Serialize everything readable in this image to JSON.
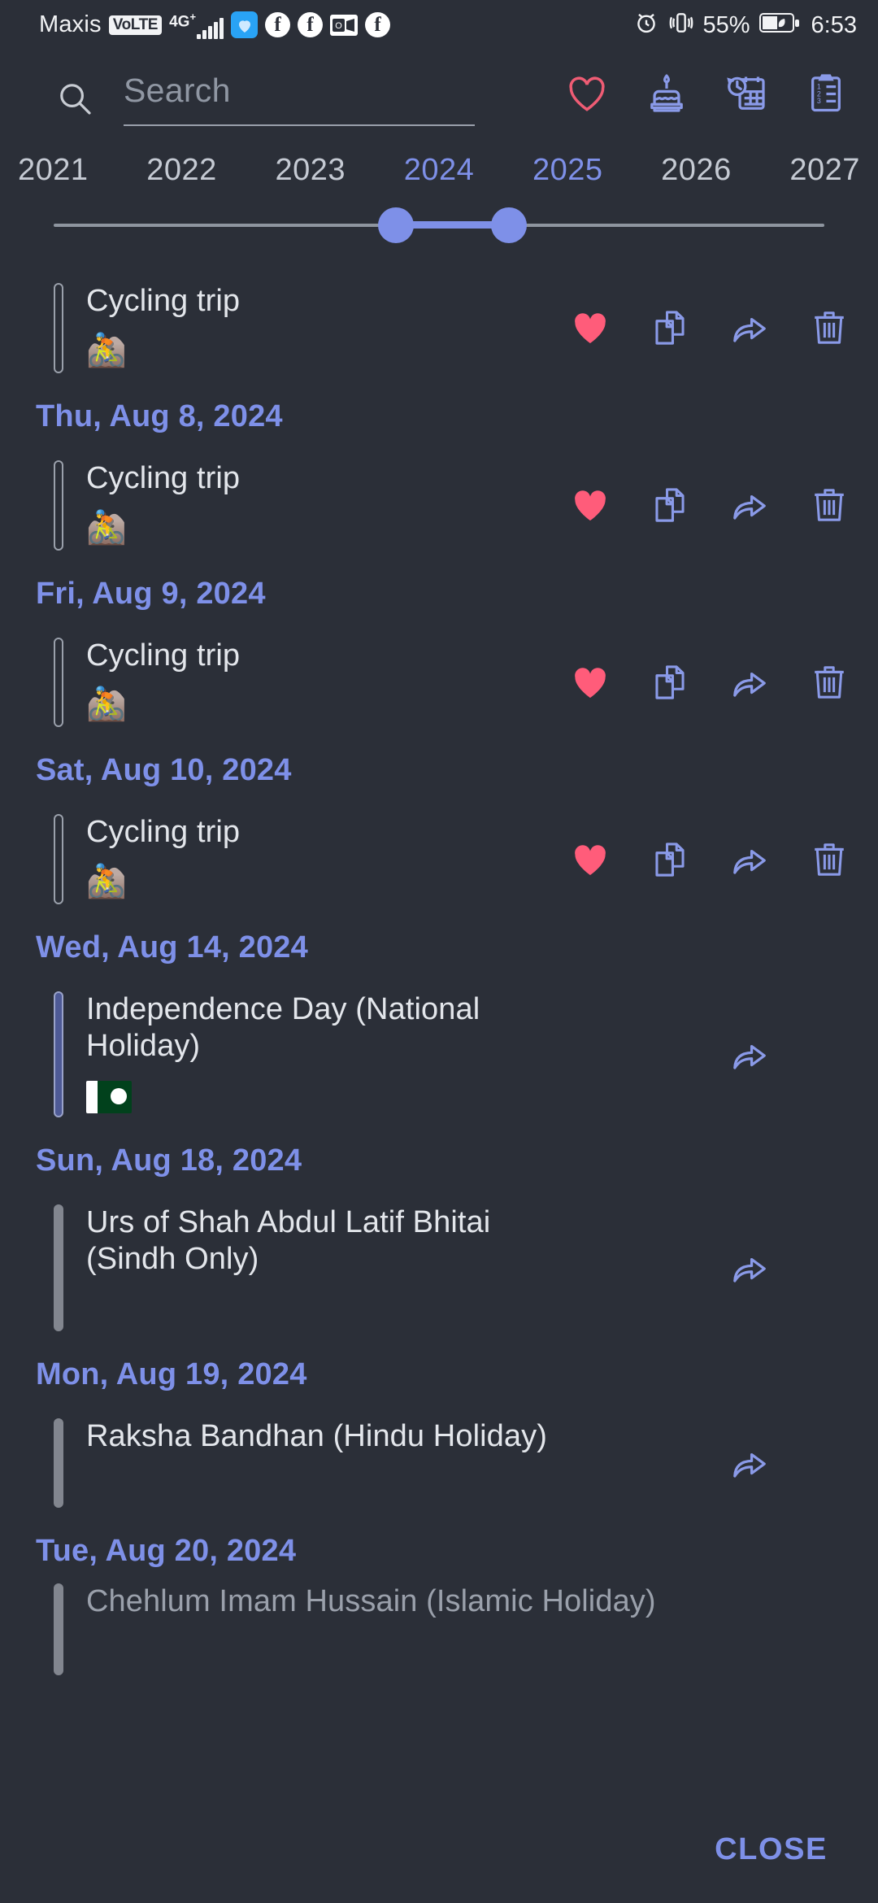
{
  "statusbar": {
    "carrier": "Maxis",
    "volte": "VoLTE",
    "network": "4G",
    "network_sup": "+",
    "battery_percent": "55%",
    "time": "6:53",
    "icons": [
      "whatsapp-like-app-icon",
      "facebook-icon",
      "facebook-icon",
      "outlook-icon",
      "facebook-icon",
      "alarm-icon",
      "vibrate-icon",
      "battery-saver-icon"
    ]
  },
  "search": {
    "placeholder": "Search",
    "value": "",
    "icon": "search-icon",
    "actions": [
      {
        "name": "favorites-icon",
        "label": "Favorites"
      },
      {
        "name": "birthday-cake-icon",
        "label": "Birthdays"
      },
      {
        "name": "calendar-clock-icon",
        "label": "Upcoming"
      },
      {
        "name": "checklist-clipboard-icon",
        "label": "Tasks"
      }
    ]
  },
  "year_slider": {
    "years": [
      "2021",
      "2022",
      "2023",
      "2024",
      "2025",
      "2026",
      "2027"
    ],
    "selected": [
      "2024",
      "2025"
    ],
    "range_start": "2024",
    "range_end": "2025",
    "accent_color": "#7e90e8",
    "track_color": "#8e959f"
  },
  "list": [
    {
      "kind": "event",
      "title": "Cycling trip",
      "emoji": "🚵",
      "bar": "outline",
      "actions": [
        "heart-filled-icon",
        "duplicate-icon",
        "share-icon",
        "delete-icon"
      ]
    },
    {
      "kind": "date",
      "date": "Thu, Aug 8, 2024"
    },
    {
      "kind": "event",
      "title": "Cycling trip",
      "emoji": "🚵",
      "bar": "outline",
      "actions": [
        "heart-filled-icon",
        "duplicate-icon",
        "share-icon",
        "delete-icon"
      ]
    },
    {
      "kind": "date",
      "date": "Fri, Aug 9, 2024"
    },
    {
      "kind": "event",
      "title": "Cycling trip",
      "emoji": "🚵",
      "bar": "outline",
      "actions": [
        "heart-filled-icon",
        "duplicate-icon",
        "share-icon",
        "delete-icon"
      ]
    },
    {
      "kind": "date",
      "date": "Sat, Aug 10, 2024"
    },
    {
      "kind": "event",
      "title": "Cycling trip",
      "emoji": "🚵",
      "bar": "outline",
      "actions": [
        "heart-filled-icon",
        "duplicate-icon",
        "share-icon",
        "delete-icon"
      ]
    },
    {
      "kind": "date",
      "date": "Wed, Aug 14, 2024"
    },
    {
      "kind": "holiday",
      "title": "Independence Day (National Holiday)",
      "emoji": "flag-pakistan",
      "bar": "blue",
      "actions": [
        "share-icon"
      ]
    },
    {
      "kind": "date",
      "date": "Sun, Aug 18, 2024"
    },
    {
      "kind": "holiday",
      "title": "Urs of Shah Abdul Latif Bhitai (Sindh Only)",
      "emoji": "",
      "bar": "gray",
      "actions": [
        "share-icon"
      ]
    },
    {
      "kind": "date",
      "date": "Mon, Aug 19, 2024"
    },
    {
      "kind": "holiday",
      "title": "Raksha Bandhan (Hindu Holiday)",
      "emoji": "",
      "bar": "gray",
      "actions": [
        "share-icon"
      ]
    },
    {
      "kind": "date",
      "date": "Tue, Aug 20, 2024"
    },
    {
      "kind": "cut",
      "title": "Chehlum Imam Hussain (Islamic Holiday)"
    }
  ],
  "footer": {
    "close_label": "CLOSE"
  },
  "colors": {
    "background": "#2b2f38",
    "accent_blue": "#7e90e8",
    "heart_pink": "#ff5c7a",
    "text_primary": "#e3e6eb",
    "text_muted": "#9097a3"
  }
}
